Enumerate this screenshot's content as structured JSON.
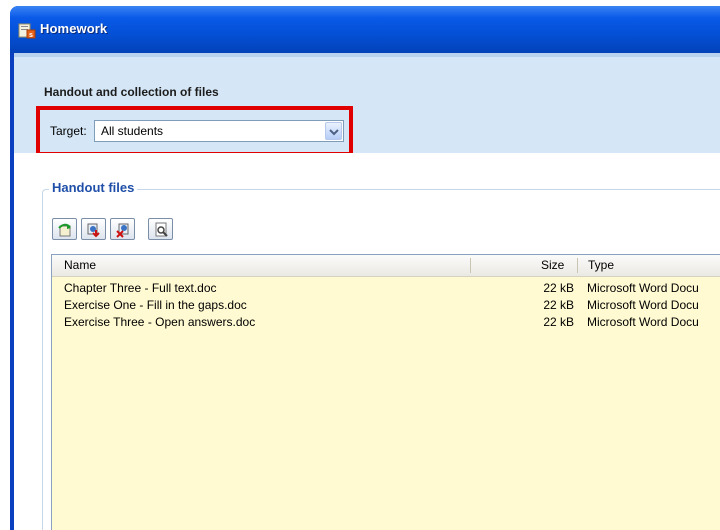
{
  "window": {
    "title": "Homework",
    "icon": "homework-app-icon"
  },
  "handout_section": {
    "title": "Handout and collection of files",
    "target_label": "Target:",
    "target_value": "All students"
  },
  "handout_files": {
    "group_title": "Handout files",
    "toolbar": [
      {
        "name": "add-file-icon"
      },
      {
        "name": "replace-file-icon"
      },
      {
        "name": "remove-file-icon"
      },
      {
        "name": "preview-file-icon"
      }
    ],
    "columns": [
      "Name",
      "Size",
      "Type"
    ],
    "rows": [
      {
        "name": "Chapter Three - Full text.doc",
        "size": "22 kB",
        "type": "Microsoft Word Docu"
      },
      {
        "name": "Exercise One - Fill in the gaps.doc",
        "size": "22 kB",
        "type": "Microsoft Word Docu"
      },
      {
        "name": "Exercise Three - Open answers.doc",
        "size": "22 kB",
        "type": "Microsoft Word Docu"
      }
    ]
  },
  "colors": {
    "title_bar": "#0450d6",
    "top_panel": "#d5e6f6",
    "highlight": "#e00000",
    "list_background": "#fffad2",
    "group_title": "#1f4fa8"
  }
}
